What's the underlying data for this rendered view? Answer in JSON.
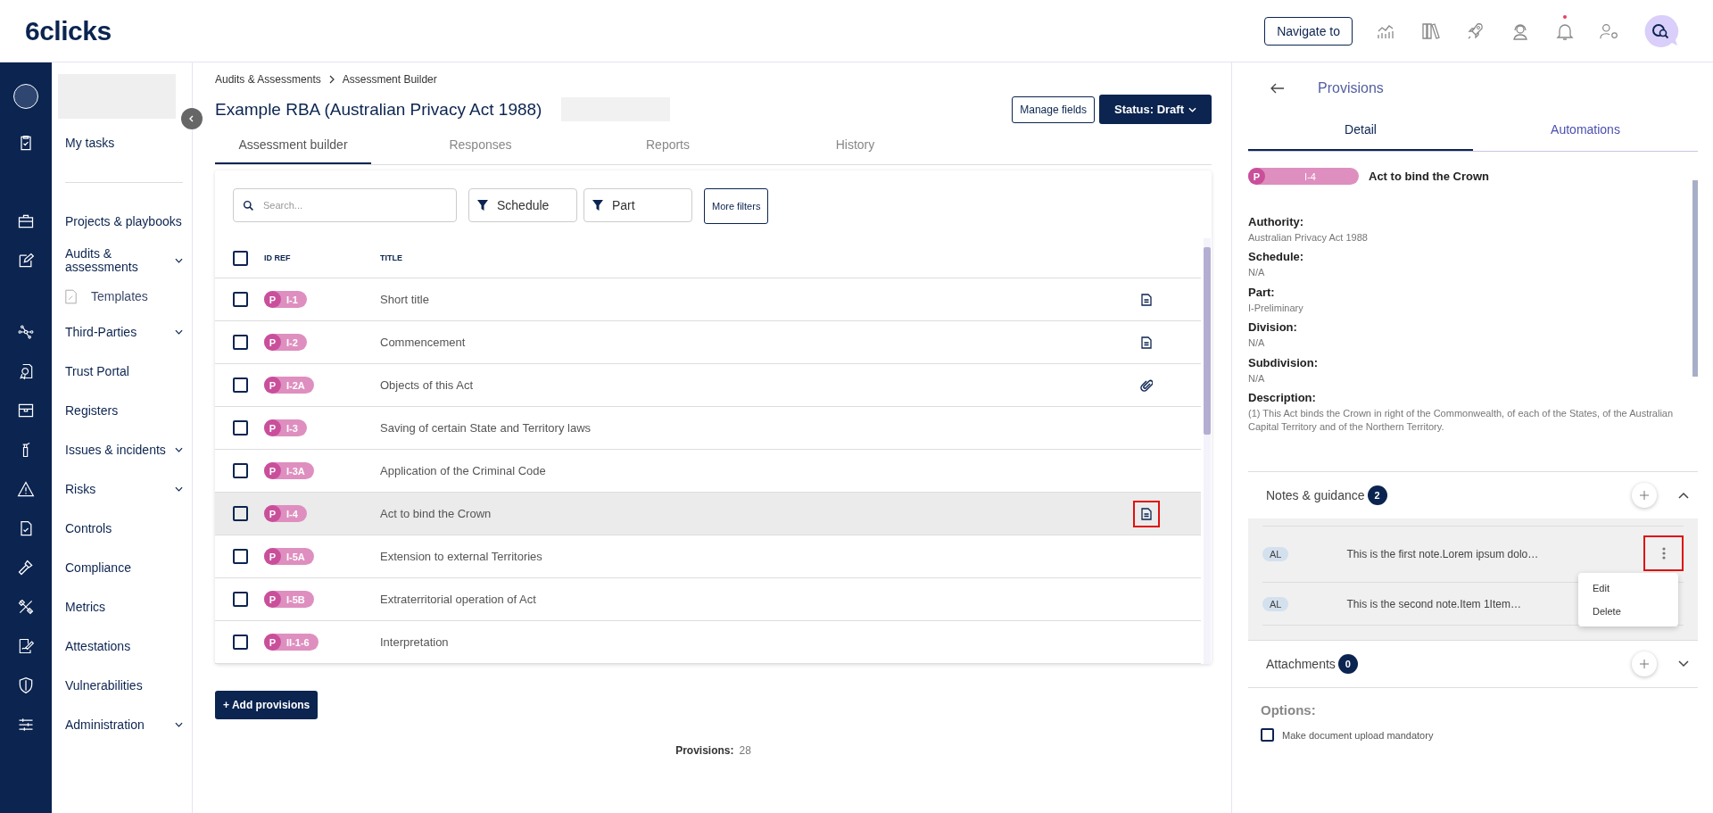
{
  "header": {
    "logo": "6clicks",
    "navigate_button": "Navigate to",
    "has_unread_notifications": true
  },
  "sidebar": {
    "sections": [
      {
        "items": [
          {
            "label": "My tasks",
            "has_submenu": false
          }
        ]
      },
      {
        "items": [
          {
            "label": "Projects & playbooks",
            "has_submenu": false
          },
          {
            "label": "Audits & assessments",
            "has_submenu": true,
            "children": [
              {
                "label": "Templates"
              }
            ]
          },
          {
            "label": "Third-Parties",
            "has_submenu": true
          },
          {
            "label": "Trust Portal",
            "has_submenu": false
          },
          {
            "label": "Registers",
            "has_submenu": false
          },
          {
            "label": "Issues & incidents",
            "has_submenu": true
          },
          {
            "label": "Risks",
            "has_submenu": true
          },
          {
            "label": "Controls",
            "has_submenu": false
          },
          {
            "label": "Compliance",
            "has_submenu": false
          },
          {
            "label": "Metrics",
            "has_submenu": false
          },
          {
            "label": "Attestations",
            "has_submenu": false
          },
          {
            "label": "Vulnerabilities",
            "has_submenu": false
          },
          {
            "label": "Administration",
            "has_submenu": true
          }
        ]
      }
    ]
  },
  "main": {
    "breadcrumb": [
      "Audits & Assessments",
      "Assessment Builder"
    ],
    "title": "Example RBA (Australian Privacy Act 1988)",
    "manage_button": "Manage fields",
    "status_button": "Status: Draft",
    "tabs": [
      {
        "label": "Assessment builder",
        "selected": true
      },
      {
        "label": "Responses",
        "selected": false
      },
      {
        "label": "Reports",
        "selected": false
      },
      {
        "label": "History",
        "selected": false
      }
    ],
    "search": {
      "placeholder": "Search..."
    },
    "filters": [
      "Schedule",
      "Part"
    ],
    "more_filters": "More filters",
    "table": {
      "columns": [
        "ID REF",
        "TITLE"
      ],
      "all_checked": false,
      "rows": [
        {
          "checked": false,
          "type": "P",
          "ref": "I-1",
          "title": "Short title",
          "kind": "notes",
          "selected": false,
          "highlighted": false
        },
        {
          "checked": false,
          "type": "P",
          "ref": "I-2",
          "title": "Commencement",
          "kind": "notes",
          "selected": false,
          "highlighted": false
        },
        {
          "checked": false,
          "type": "P",
          "ref": "I-2A",
          "title": "Objects of this Act",
          "kind": "attachments",
          "selected": false,
          "highlighted": false
        },
        {
          "checked": false,
          "type": "P",
          "ref": "I-3",
          "title": "Saving of certain State and Territory laws",
          "kind": "plain",
          "selected": false,
          "highlighted": false
        },
        {
          "checked": false,
          "type": "P",
          "ref": "I-3A",
          "title": "Application of the Criminal Code",
          "kind": "plain",
          "selected": false,
          "highlighted": false
        },
        {
          "checked": false,
          "type": "P",
          "ref": "I-4",
          "title": "Act to bind the Crown",
          "kind": "notes",
          "selected": true,
          "highlighted": true
        },
        {
          "checked": false,
          "type": "P",
          "ref": "I-5A",
          "title": "Extension to external Territories",
          "kind": "plain",
          "selected": false,
          "highlighted": false
        },
        {
          "checked": false,
          "type": "P",
          "ref": "I-5B",
          "title": "Extraterritorial operation of Act",
          "kind": "plain",
          "selected": false,
          "highlighted": false
        },
        {
          "checked": false,
          "type": "P",
          "ref": "II-1-6",
          "title": "Interpretation",
          "kind": "plain",
          "selected": false,
          "highlighted": false
        }
      ]
    },
    "add_button": "+ Add provisions",
    "footer": {
      "label": "Provisions:",
      "count": "28"
    }
  },
  "detail": {
    "title": "Provisions",
    "tabs": [
      {
        "label": "Detail",
        "selected": true
      },
      {
        "label": "Automations",
        "selected": false
      }
    ],
    "badge": {
      "type": "P",
      "ref": "I-4"
    },
    "heading": "Act to bind the Crown",
    "fields": [
      {
        "label": "Authority:",
        "value": "Australian Privacy Act 1988"
      },
      {
        "label": "Schedule:",
        "value": "N/A"
      },
      {
        "label": "Part:",
        "value": "I-Preliminary"
      },
      {
        "label": "Division:",
        "value": "N/A"
      },
      {
        "label": "Subdivision:",
        "value": "N/A"
      },
      {
        "label": "Description:",
        "value": "(1) This Act binds the Crown in right of the Commonwealth, of each of the States, of the Australian Capital Territory and of the Northern Territory."
      }
    ],
    "sections": [
      {
        "title": "Notes & guidance",
        "count": "2",
        "expanded": true,
        "notes": [
          {
            "initials": "AL",
            "text": "This is the first note.Lorem ipsum dolo…",
            "has_menu_button": true,
            "highlighted": true,
            "menu_open": true,
            "menu_items": [
              "Edit",
              "Delete"
            ]
          },
          {
            "initials": "AL",
            "text": "This is the second note.Item 1Item…",
            "has_menu_button": false,
            "menu_open": false
          }
        ]
      },
      {
        "title": "Attachments",
        "count": "0",
        "expanded": false
      }
    ],
    "options": {
      "title": "Options:",
      "items": [
        {
          "label": "Make document upload mandatory",
          "checked": false
        }
      ]
    }
  }
}
